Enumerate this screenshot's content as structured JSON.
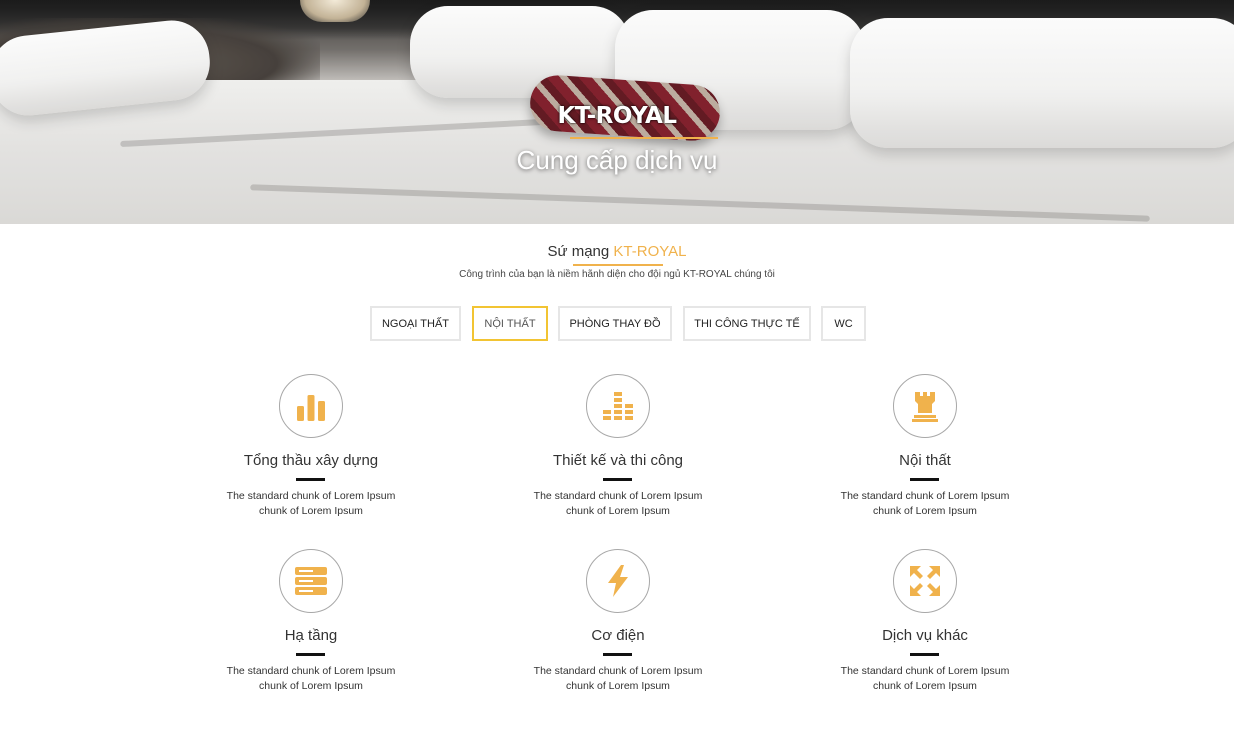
{
  "hero": {
    "brand": "KT-ROYAL",
    "subtitle": "Cung cấp dịch vụ"
  },
  "mission": {
    "title_prefix": "Sứ mạng",
    "title_accent": "KT-ROYAL",
    "description": "Công trình của bạn là niềm hãnh diện cho đội ngủ KT-ROYAL chúng tôi"
  },
  "tabs": [
    {
      "label": "NGOẠI THẤT",
      "active": false
    },
    {
      "label": "NỘI THẤT",
      "active": true
    },
    {
      "label": "PHÒNG THAY ĐỒ",
      "active": false
    },
    {
      "label": "THI CÔNG THỰC TẾ",
      "active": false
    },
    {
      "label": "WC",
      "active": false
    }
  ],
  "services": [
    {
      "title": "Tổng thầu xây dựng",
      "desc_line1": "The standard chunk of Lorem Ipsum",
      "desc_line2": "chunk of Lorem Ipsum",
      "icon": "bar-chart-icon"
    },
    {
      "title": "Thiết kế và thi công",
      "desc_line1": "The standard chunk of Lorem Ipsum",
      "desc_line2": "chunk of Lorem Ipsum",
      "icon": "equalizer-icon"
    },
    {
      "title": "Nội thất",
      "desc_line1": "The standard chunk of Lorem Ipsum",
      "desc_line2": "chunk of Lorem Ipsum",
      "icon": "chess-rook-icon"
    },
    {
      "title": "Hạ tầng",
      "desc_line1": "The standard chunk of Lorem Ipsum",
      "desc_line2": "chunk of Lorem Ipsum",
      "icon": "server-icon"
    },
    {
      "title": "Cơ điện",
      "desc_line1": "The standard chunk of Lorem Ipsum",
      "desc_line2": "chunk of Lorem Ipsum",
      "icon": "lightning-icon"
    },
    {
      "title": "Dịch vụ khác",
      "desc_line1": "The standard chunk of Lorem Ipsum",
      "desc_line2": "chunk of Lorem Ipsum",
      "icon": "expand-icon"
    }
  ],
  "colors": {
    "accent": "#f0b24c",
    "tab_active_border": "#f2c433",
    "icon_fill": "#f0b24c"
  }
}
